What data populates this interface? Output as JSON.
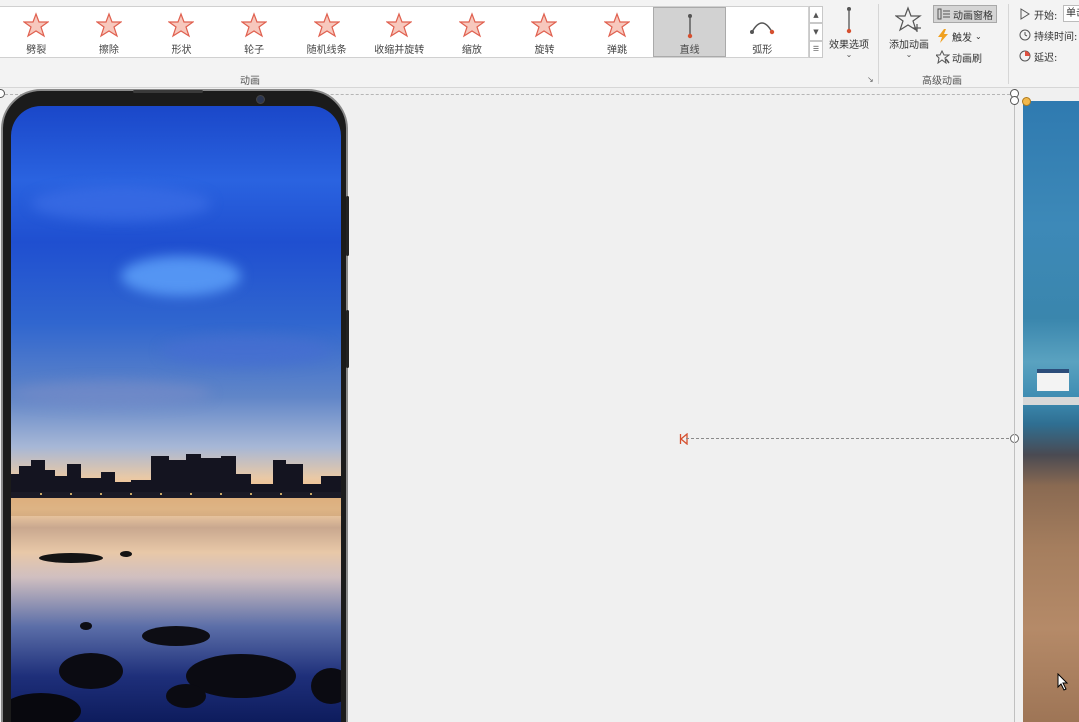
{
  "ribbon": {
    "gallery_items": [
      {
        "label": "劈裂",
        "icon": "split-star-icon"
      },
      {
        "label": "擦除",
        "icon": "wipe-star-icon"
      },
      {
        "label": "形状",
        "icon": "shape-star-icon"
      },
      {
        "label": "轮子",
        "icon": "wheel-star-icon"
      },
      {
        "label": "随机线条",
        "icon": "random-bars-star-icon"
      },
      {
        "label": "收缩并旋转",
        "icon": "shrink-turn-star-icon"
      },
      {
        "label": "缩放",
        "icon": "zoom-star-icon"
      },
      {
        "label": "旋转",
        "icon": "spin-star-icon"
      },
      {
        "label": "弹跳",
        "icon": "bounce-star-icon"
      },
      {
        "label": "直线",
        "icon": "line-path-icon",
        "selected": true
      },
      {
        "label": "弧形",
        "icon": "arc-path-icon"
      }
    ],
    "animation_group_label": "动画",
    "effect_options_label": "效果选项",
    "add_animation_label": "添加动画",
    "advanced_group_label": "高级动画",
    "animation_pane_label": "动画窗格",
    "trigger_label": "触发",
    "animation_painter_label": "动画刷",
    "start_label": "开始:",
    "start_value": "单击时",
    "duration_label": "持续时间:",
    "delay_label": "延迟:"
  },
  "colors": {
    "accent_star": "#e0604f",
    "path_marker": "#d6502f",
    "selected_bg": "#d2d2d2"
  }
}
